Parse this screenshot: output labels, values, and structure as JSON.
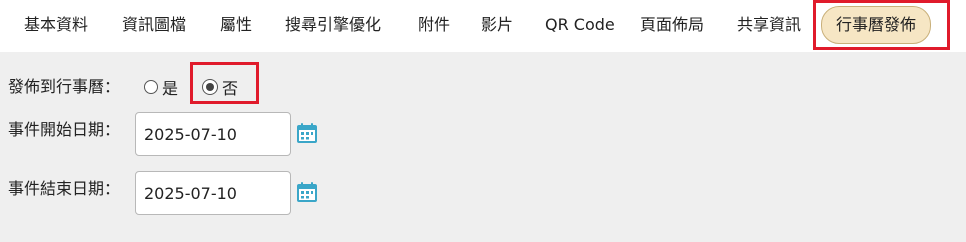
{
  "tabs": [
    {
      "label": "基本資料"
    },
    {
      "label": "資訊圖檔"
    },
    {
      "label": "屬性"
    },
    {
      "label": "搜尋引擎優化"
    },
    {
      "label": "附件"
    },
    {
      "label": "影片"
    },
    {
      "label": "QR Code"
    },
    {
      "label": "頁面佈局"
    },
    {
      "label": "共享資訊"
    },
    {
      "label": "行事曆發佈",
      "active": true
    }
  ],
  "form": {
    "publish_label": "發佈到行事曆：",
    "publish_options": [
      {
        "label": "是",
        "checked": false
      },
      {
        "label": "否",
        "checked": true
      }
    ],
    "start_label": "事件開始日期：",
    "start_value": "2025-07-10",
    "end_label": "事件結束日期：",
    "end_value": "2025-07-10"
  },
  "colors": {
    "highlight": "#e01b2b",
    "active_tab_bg": "#f6e6c4",
    "calendar_icon": "#3aa6c8"
  },
  "icons": [
    "calendar-icon"
  ]
}
